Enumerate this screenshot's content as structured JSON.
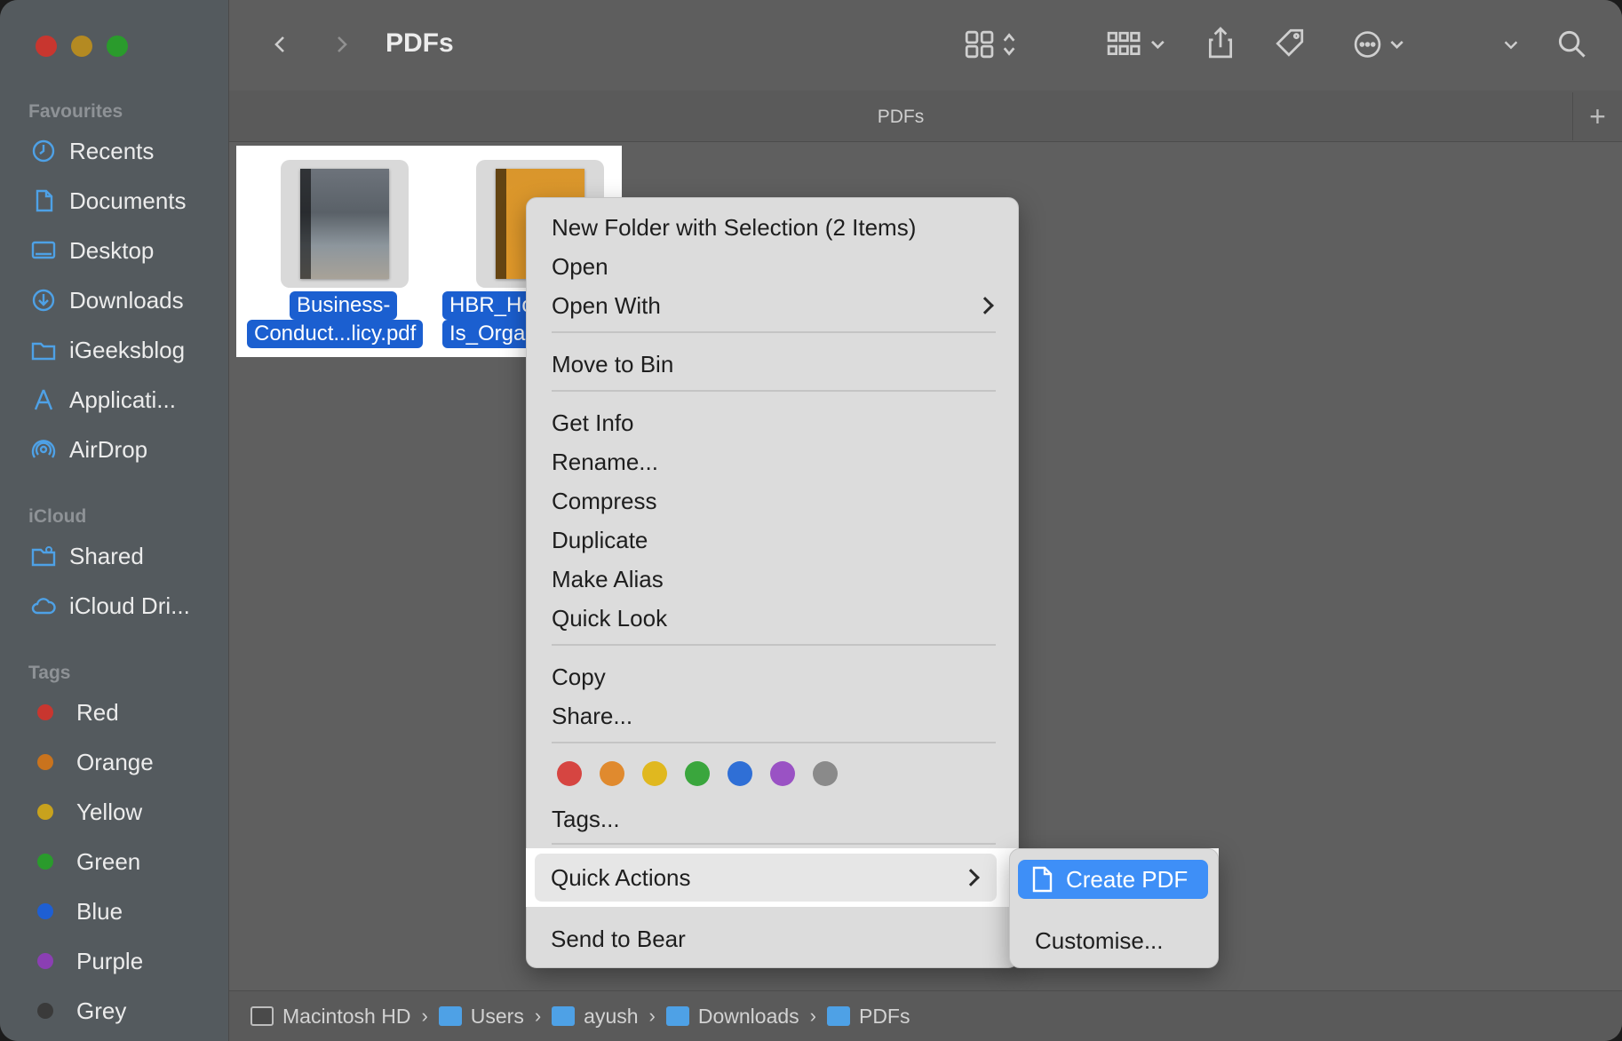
{
  "window": {
    "title": "PDFs",
    "tab_label": "PDFs",
    "tab_add": "+"
  },
  "sidebar": {
    "favourites_heading": "Favourites",
    "favourites": [
      {
        "label": "Recents",
        "icon": "clock-icon"
      },
      {
        "label": "Documents",
        "icon": "document-icon"
      },
      {
        "label": "Desktop",
        "icon": "desktop-icon"
      },
      {
        "label": "Downloads",
        "icon": "download-icon"
      },
      {
        "label": "iGeeksblog",
        "icon": "folder-icon"
      },
      {
        "label": "Applicati...",
        "icon": "applications-icon"
      },
      {
        "label": "AirDrop",
        "icon": "airdrop-icon"
      }
    ],
    "icloud_heading": "iCloud",
    "icloud": [
      {
        "label": "Shared",
        "icon": "shared-folder-icon"
      },
      {
        "label": "iCloud Dri...",
        "icon": "cloud-icon"
      }
    ],
    "tags_heading": "Tags",
    "tags": [
      {
        "label": "Red",
        "color": "#c8362f"
      },
      {
        "label": "Orange",
        "color": "#c9731d"
      },
      {
        "label": "Yellow",
        "color": "#c8a21d"
      },
      {
        "label": "Green",
        "color": "#2a9b2c"
      },
      {
        "label": "Blue",
        "color": "#1e5fd3"
      },
      {
        "label": "Purple",
        "color": "#8b3fb3"
      },
      {
        "label": "Grey",
        "color": "#3a3a3a"
      }
    ]
  },
  "files": [
    {
      "label_line1": "Business-",
      "label_line2": "Conduct...licy.pdf"
    },
    {
      "label_line1": "HBR_Ho",
      "label_line2": "Is_Orga"
    }
  ],
  "context_menu": {
    "items": [
      "New Folder with Selection (2 Items)",
      "Open",
      "Open With",
      "Move to Bin",
      "Get Info",
      "Rename...",
      "Compress",
      "Duplicate",
      "Make Alias",
      "Quick Look",
      "Copy",
      "Share...",
      "Tags...",
      "Quick Actions",
      "Send to Bear"
    ],
    "tag_colors": [
      "#d64541",
      "#e08a2e",
      "#e0b81f",
      "#3aa63d",
      "#2f6fd6",
      "#9a52c4",
      "#8a8a8a"
    ]
  },
  "submenu": {
    "create_pdf": "Create PDF",
    "customise": "Customise..."
  },
  "pathbar": [
    "Macintosh HD",
    "Users",
    "ayush",
    "Downloads",
    "PDFs"
  ]
}
